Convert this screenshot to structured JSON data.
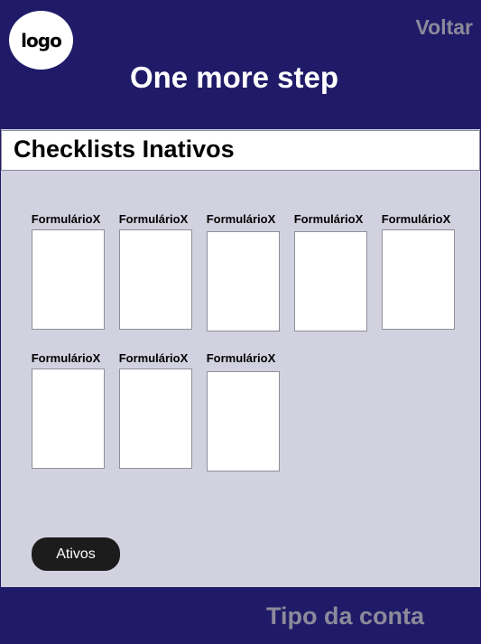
{
  "header": {
    "logo_text": "logo",
    "back_label": "Voltar",
    "title": "One more step"
  },
  "section": {
    "title": "Checklists Inativos"
  },
  "forms": [
    {
      "label": "FormulárioX"
    },
    {
      "label": "FormulárioX"
    },
    {
      "label": "FormulárioX"
    },
    {
      "label": "FormulárioX"
    },
    {
      "label": "FormulárioX"
    },
    {
      "label": "FormulárioX"
    },
    {
      "label": "FormulárioX"
    },
    {
      "label": "FormulárioX"
    }
  ],
  "actions": {
    "ativos_label": "Ativos"
  },
  "footer": {
    "account_type_label": "Tipo da conta"
  },
  "colors": {
    "navy": "#201b68",
    "panel": "#d2d1df",
    "muted_text": "#8c8a9a",
    "button": "#1c1c1c"
  }
}
